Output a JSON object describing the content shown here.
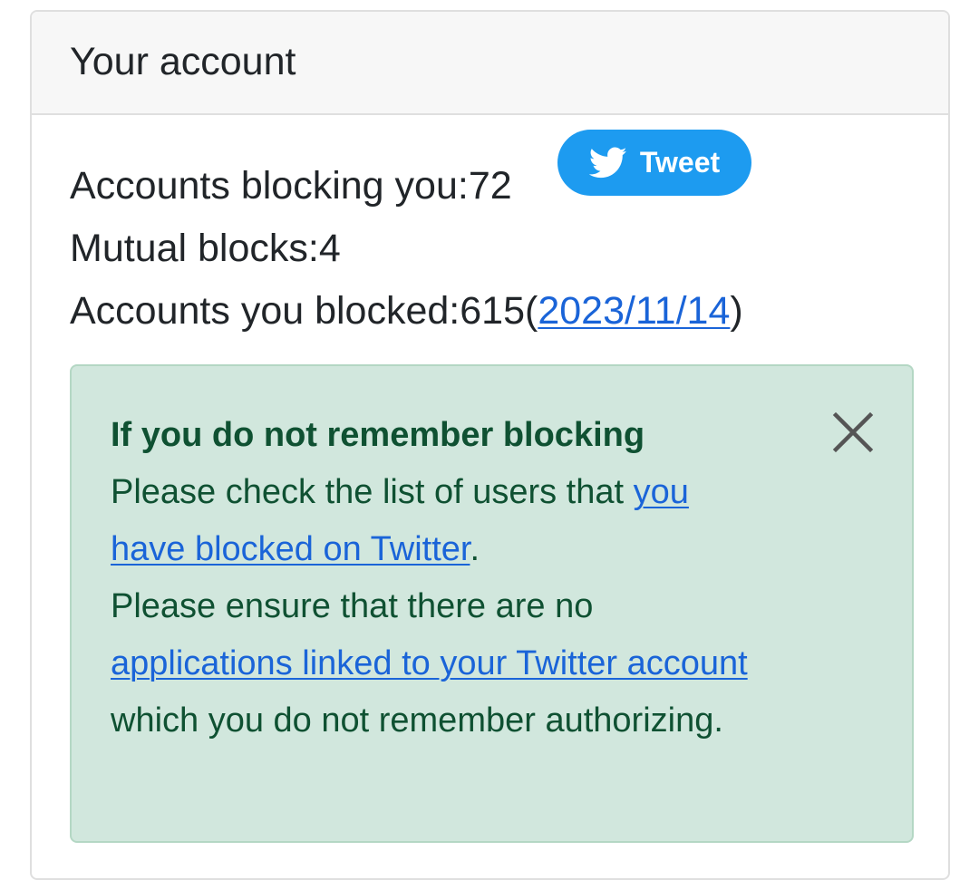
{
  "card": {
    "title": "Your account"
  },
  "stats": {
    "blocking_you_label": "Accounts blocking you:",
    "blocking_you_count": "72",
    "mutual_label": "Mutual blocks:",
    "mutual_count": "4",
    "you_blocked_label": "Accounts you blocked:",
    "you_blocked_count": "615",
    "open_paren": "(",
    "date_link": "2023/11/14",
    "close_paren": ")"
  },
  "tweet_button": {
    "label": "Tweet",
    "icon": "twitter-bird-icon",
    "color": "#1d9bf0"
  },
  "alert": {
    "heading": "If you do not remember blocking",
    "line1_text": "Please check the list of users that ",
    "line1_link": "you have blocked on Twitter",
    "line1_end": ".",
    "line2_text": "Please ensure that there are no ",
    "line2_link": "applications linked to your Twitter account",
    "line2_end": " which you do not remember authorizing.",
    "close_icon": "close-icon",
    "background": "#d1e7dd",
    "text_color": "#0f5132"
  },
  "colors": {
    "link": "#1a64d8"
  }
}
